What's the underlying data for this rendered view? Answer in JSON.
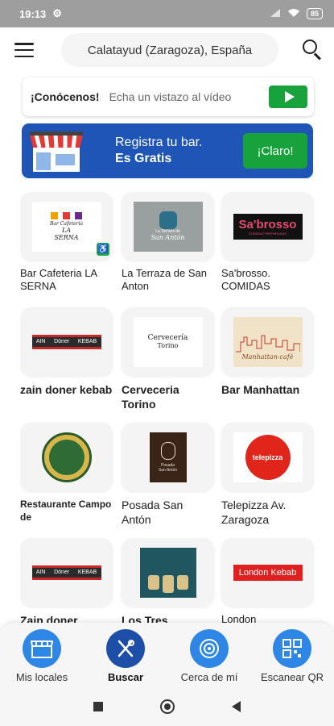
{
  "status_bar": {
    "time": "19:13",
    "battery": "85"
  },
  "header": {
    "location": "Calatayud (Zaragoza), España"
  },
  "video_banner": {
    "title": "¡Conócenos!",
    "subtitle": "Echa un vistazo al vídeo"
  },
  "register_banner": {
    "line1": "Registra tu bar.",
    "line2": "Es Gratis",
    "button": "¡Claro!"
  },
  "bars": [
    {
      "name": "Bar Cafeteria LA SERNA",
      "logo_text": [
        "Bar Cafetería",
        "LA",
        "SERNA"
      ]
    },
    {
      "name": "La Terraza de San Anton",
      "logo_text": [
        "La Terraza de",
        "San Antón"
      ]
    },
    {
      "name": "Sa'brosso. COMIDAS",
      "logo_text": [
        "Sa'brosso",
        "COMIDAS PREPARADAS"
      ]
    },
    {
      "name": "zain doner kebab",
      "logo_text": [
        "AIN",
        "Döner",
        "KEBAB"
      ]
    },
    {
      "name": "Cerveceria Torino",
      "logo_text": [
        "Cervecería",
        "Torino"
      ]
    },
    {
      "name": "Bar Manhattan",
      "logo_text": [
        "Manhattan-café"
      ]
    },
    {
      "name": "Restaurante Campo de",
      "logo_text": []
    },
    {
      "name": "Posada San Antón",
      "logo_text": [
        "Posada",
        "San Antón"
      ]
    },
    {
      "name": "Telepizza Av. Zaragoza",
      "logo_text": [
        "telepizza"
      ]
    },
    {
      "name": "Zain doner",
      "logo_text": [
        "AIN",
        "Döner",
        "KEBAB"
      ]
    },
    {
      "name": "Los Tres",
      "logo_text": [
        "Los Tres"
      ]
    },
    {
      "name": "London",
      "logo_text": [
        "London Kebab"
      ]
    }
  ],
  "bottom_nav": [
    {
      "label": "Mis locales",
      "icon": "store-icon"
    },
    {
      "label": "Buscar",
      "icon": "cutlery-icon"
    },
    {
      "label": "Cerca de mí",
      "icon": "radar-icon"
    },
    {
      "label": "Escanear QR",
      "icon": "qr-icon"
    }
  ],
  "colors": {
    "accent_blue": "#1e55b6",
    "green": "#17a23b",
    "nav_blue": "#2e86e6"
  }
}
